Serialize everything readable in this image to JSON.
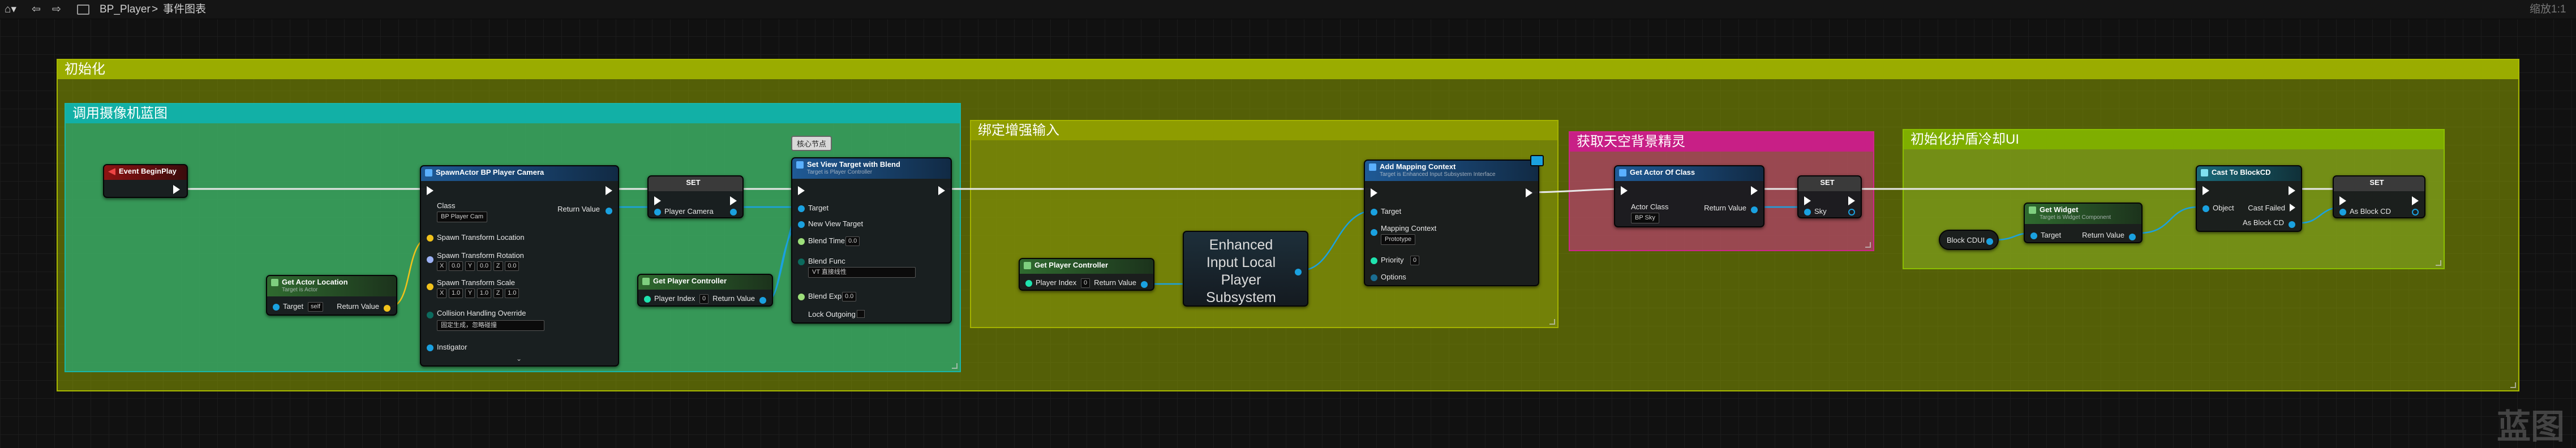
{
  "toolbar": {
    "breadcrumb_blueprint": "BP_Player",
    "breadcrumb_sep": ">",
    "breadcrumb_graph": "事件图表",
    "zoom": "缩放1:1"
  },
  "watermark": "蓝图",
  "comments": {
    "init": "初始化",
    "camera": "调用摄像机蓝图",
    "input": "绑定增强输入",
    "sky": "获取天空背景精灵",
    "shield": "初始化护盾冷却UI"
  },
  "nodes": {
    "begin_play": {
      "title": "Event BeginPlay"
    },
    "spawn": {
      "title": "SpawnActor BP Player Camera",
      "class_label": "Class",
      "class_value": "BP Player Cam",
      "return_label": "Return Value",
      "spawn_loc": "Spawn Transform Location",
      "spawn_rot": "Spawn Transform Rotation",
      "rot_values": [
        "0.0",
        "0.0",
        "0.0"
      ],
      "spawn_scale": "Spawn Transform Scale",
      "scale_values": [
        "1.0",
        "1.0",
        "1.0"
      ],
      "collision": "Collision Handling Override",
      "collision_value": "固定生成，忽略碰撞",
      "instigator": "Instigator",
      "axis_x": "X",
      "axis_y": "Y",
      "axis_z": "Z"
    },
    "get_actor_location": {
      "title": "Get Actor Location",
      "subtitle": "Target is Actor",
      "target": "Target",
      "target_value": "self",
      "return_label": "Return Value"
    },
    "set_camera": {
      "title": "SET",
      "pin": "Player Camera"
    },
    "get_player_controller_1": {
      "title": "Get Player Controller",
      "player_index": "Player Index",
      "index_value": "0",
      "return_label": "Return Value"
    },
    "view_target": {
      "tag": "核心节点",
      "title": "Set View Target with Blend",
      "subtitle": "Target is Player Controller",
      "target": "Target",
      "new_view_target": "New View Target",
      "blend_time": "Blend Time",
      "blend_time_value": "0.0",
      "blend_func": "Blend Func",
      "blend_func_value": "VT 直接线性",
      "blend_exp": "Blend Exp",
      "blend_exp_value": "0.0",
      "lock_outgoing": "Lock Outgoing"
    },
    "get_player_controller_2": {
      "title": "Get Player Controller",
      "player_index": "Player Index",
      "index_value": "0",
      "return_label": "Return Value"
    },
    "enhanced_input": {
      "title": "Enhanced Input Local Player Subsystem"
    },
    "add_mapping": {
      "title": "Add Mapping Context",
      "subtitle": "Target is Enhanced Input Subsystem Interface",
      "target": "Target",
      "mapping_context": "Mapping Context",
      "mapping_value": "Prototype",
      "priority": "Priority",
      "priority_value": "0",
      "options": "Options"
    },
    "get_actor_of_class": {
      "title": "Get Actor Of Class",
      "actor_class": "Actor Class",
      "actor_value": "BP Sky",
      "return_label": "Return Value"
    },
    "set_sky": {
      "title": "SET",
      "pin": "Sky"
    },
    "block_cd_var": {
      "title": "Block CDUI"
    },
    "get_widget": {
      "title": "Get Widget",
      "subtitle": "Target is Widget Component",
      "target": "Target",
      "return_label": "Return Value"
    },
    "cast": {
      "title": "Cast To BlockCD",
      "object": "Object",
      "cast_failed": "Cast Failed",
      "as_block": "As Block CD"
    },
    "set_block": {
      "title": "SET",
      "pin": "As Block CD"
    }
  },
  "colors": {
    "init_comment": "#8a9a00",
    "camera_comment": "#2ea56c",
    "input_comment": "#7d8c0a",
    "sky_comment": "#b0406a",
    "shield_comment": "#7a9a1a",
    "event_head": "#7a1010",
    "function_head": "#1e4a78",
    "pure_head": "#2f5a2f",
    "var_set_head": "#3a3a3a",
    "cast_head": "#1a5a6a",
    "object_pin": "#1aa1e0",
    "vector_pin": "#f1c21b",
    "float_pin": "#9ddf7a",
    "exec_pin": "#ffffff"
  }
}
